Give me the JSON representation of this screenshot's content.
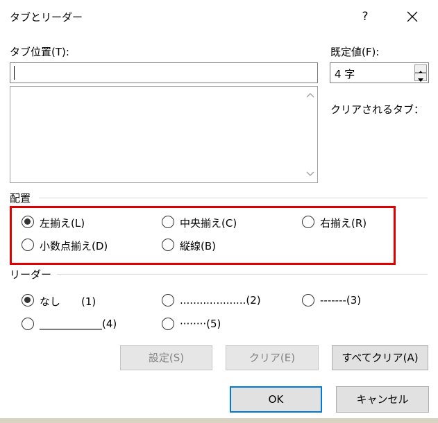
{
  "dialog": {
    "title": "タブとリーダー",
    "help_label": "?"
  },
  "tab_position": {
    "label": "タブ位置(T):",
    "value": ""
  },
  "default": {
    "label": "既定値(F):",
    "value": "4 字"
  },
  "cleared_tabs_label": "クリアされるタブ：",
  "alignment": {
    "label": "配置",
    "options": [
      {
        "label": "左揃え(L)",
        "checked": true
      },
      {
        "label": "中央揃え(C)",
        "checked": false
      },
      {
        "label": "右揃え(R)",
        "checked": false
      },
      {
        "label": "小数点揃え(D)",
        "checked": false
      },
      {
        "label": "縦線(B)",
        "checked": false
      }
    ]
  },
  "leader": {
    "label": "リーダー",
    "options": [
      {
        "label": "なし　　(1)",
        "checked": true
      },
      {
        "label": "....................(2)",
        "checked": false
      },
      {
        "label": "-------(3)",
        "checked": false
      },
      {
        "label": "____________(4)",
        "checked": false
      },
      {
        "label": "········(5)",
        "checked": false
      }
    ]
  },
  "buttons": {
    "set": "設定(S)",
    "clear": "クリア(E)",
    "clear_all": "すべてクリア(A)",
    "ok": "OK",
    "cancel": "キャンセル"
  },
  "colors": {
    "highlight": "#e00000",
    "accent": "#0078d7"
  }
}
